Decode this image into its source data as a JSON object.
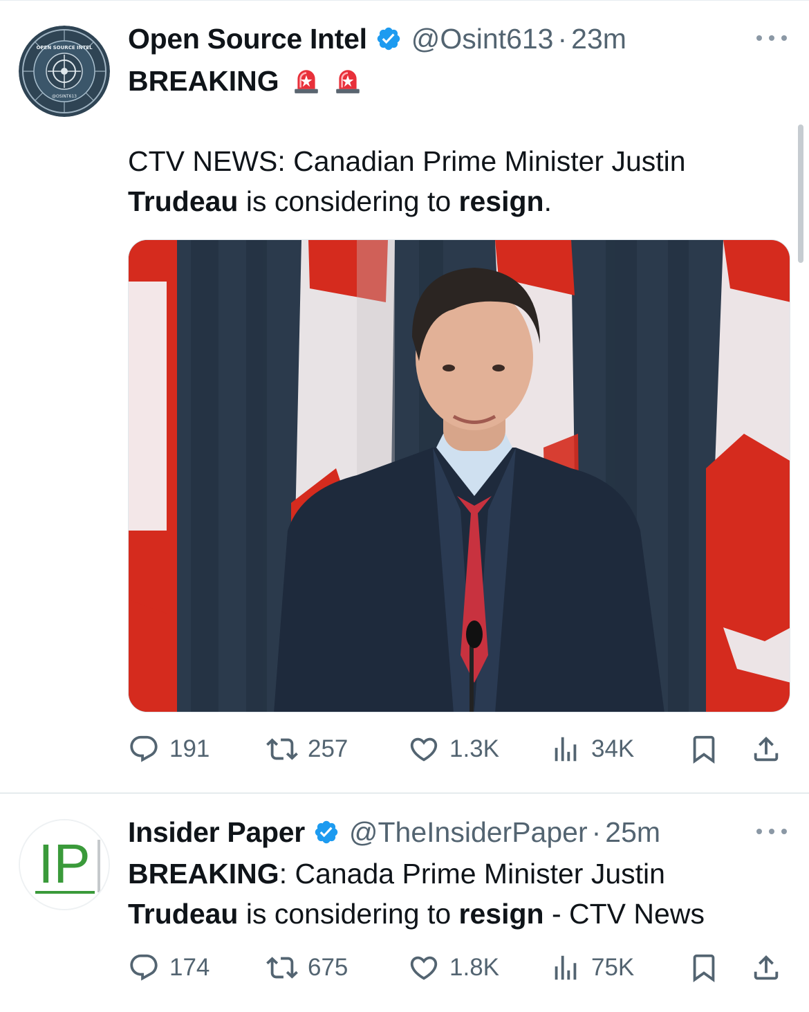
{
  "tweets": [
    {
      "display_name": "Open Source Intel",
      "handle": "@Osint613",
      "separator": "·",
      "time": "23m",
      "headline": "BREAKING",
      "headline_emoji": "police-car-light-emoji",
      "text_line1": "CTV NEWS: Canadian Prime Minister Justin",
      "text_line2_bold1": "Trudeau",
      "text_line2_mid": " is considering to ",
      "text_line2_bold2": "resign",
      "text_line2_end": ".",
      "avatar_text": {
        "top": "OPEN SOURCE INTEL",
        "bottom": "@OSINT613"
      },
      "stats": {
        "replies": "191",
        "reposts": "257",
        "likes": "1.3K",
        "views": "34K"
      }
    },
    {
      "display_name": "Insider Paper",
      "handle": "@TheInsiderPaper",
      "separator": "·",
      "time": "25m",
      "text_line1_bold": "BREAKING",
      "text_line1_rest": ": Canada Prime Minister Justin",
      "text_line2_bold1": "Trudeau",
      "text_line2_mid": " is considering to ",
      "text_line2_bold2": "resign",
      "text_line2_end": " - CTV News",
      "avatar_text": "IP",
      "stats": {
        "replies": "174",
        "reposts": "675",
        "likes": "1.8K",
        "views": "75K"
      }
    }
  ],
  "colors": {
    "text": "#0f1419",
    "secondary": "#536471",
    "verified": "#1d9bf0",
    "flag_red": "#d52b1e",
    "curtain": "#2b3a4c",
    "avatar_dark": "#2f4454",
    "ip_green": "#3a9a3a"
  }
}
